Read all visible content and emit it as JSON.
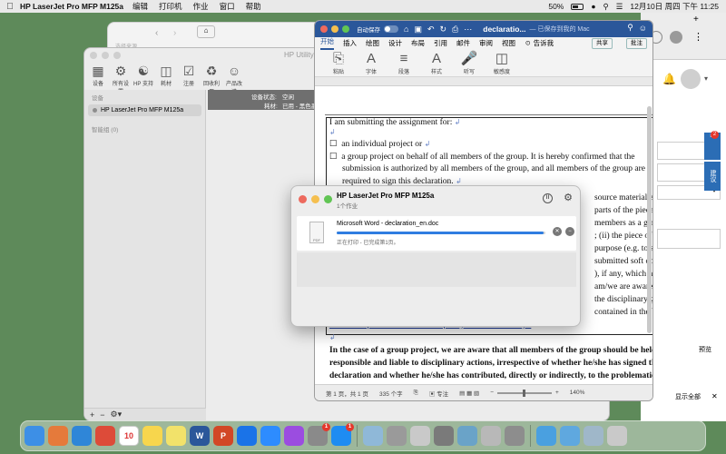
{
  "menubar": {
    "app_name": "HP LaserJet Pro MFP M125a",
    "menus": [
      "编辑",
      "打印机",
      "作业",
      "窗口",
      "帮助"
    ],
    "battery": "50%",
    "clock": "12月10日 周四 下午 11:25"
  },
  "hp_utility": {
    "title": "HP Utility",
    "toolbar": [
      "设备",
      "所有设置",
      "HP 支持",
      "耗材",
      "注册",
      "回收利用",
      "产品改进"
    ],
    "sidebar_header": "设备",
    "device": "HP LaserJet Pro MFP M125a",
    "smart_group": "智能组 (0)",
    "status_label": "设备状态:",
    "status_value": "空闲",
    "supply_label": "耗材:",
    "supply_value": "已用 - 黑色墨"
  },
  "word": {
    "autosave_label": "自动保存",
    "doc_title": "declaratio...",
    "doc_subtitle": "— 已保存到我的 Mac",
    "tabs": [
      "开始",
      "插入",
      "绘图",
      "设计",
      "布局",
      "引用",
      "邮件",
      "审阅",
      "视图"
    ],
    "tell_me": "告诉我",
    "share": "共享",
    "comment": "批注",
    "ribbon": [
      "粘贴",
      "字体",
      "段落",
      "样式",
      "听写",
      "敏感度"
    ],
    "lines": [
      "I am submitting the assignment for:",
      "an individual project or",
      "a group project on behalf of all members of the group. It is hereby confirmed that the",
      "submission is authorized by all members of the group, and all members of the group are",
      "required to sign this declaration.",
      "source material except to",
      "parts of the piece of",
      "members as a group,",
      "; (ii) the piece of work",
      "purpose (e.g. to satisfy",
      "submitted soft copy",
      "), if any, which has",
      "am/we are aware of",
      "the disciplinary guidelines",
      "contained in the University",
      "website http://www.cuhk.edu.hk/policy/academichonesty/.",
      "In the case of a group project, we are aware that all members of the group should be held",
      "responsible and liable to disciplinary actions, irrespective of whether he/she has signed the",
      "declaration and whether he/she has contributed, directly or indirectly, to the problematic"
    ],
    "status": {
      "page": "第 1 页，共 1 页",
      "words": "335 个字",
      "focus": "专注",
      "zoom": "140%"
    }
  },
  "print_queue": {
    "printer": "HP LaserJet Pro MFP M125a",
    "jobs_count": "1个作业",
    "job_name": "Microsoft Word - declaration_en.doc",
    "job_status": "正在打印 - 已完成第1页。",
    "progress": 0.99,
    "file_label": "PDF"
  },
  "chrome": {
    "badge": "2",
    "side_label": "建议",
    "preview": "预览",
    "show_all": "显示全部",
    "hidden_tab": "选择来源"
  },
  "dock": [
    {
      "name": "finder",
      "label": "",
      "color": "#3d8fe6"
    },
    {
      "name": "launchpad",
      "label": "",
      "color": "#e57a3b"
    },
    {
      "name": "safari",
      "label": "",
      "color": "#2f86d8"
    },
    {
      "name": "chrome",
      "label": "",
      "color": "#dd4b39"
    },
    {
      "name": "calendar",
      "label": "10",
      "color": "#ffffff"
    },
    {
      "name": "notes",
      "label": "",
      "color": "#f7d64d"
    },
    {
      "name": "stickies",
      "label": "",
      "color": "#f2e26a"
    },
    {
      "name": "word",
      "label": "W",
      "color": "#2b579a"
    },
    {
      "name": "powerpoint",
      "label": "P",
      "color": "#d24726"
    },
    {
      "name": "onedrive",
      "label": "",
      "color": "#1a73e8"
    },
    {
      "name": "zoom",
      "label": "",
      "color": "#2d8cff"
    },
    {
      "name": "podcasts",
      "label": "",
      "color": "#9b4de0"
    },
    {
      "name": "system-preferences",
      "label": "",
      "color": "#8a8a8a",
      "badge": "1"
    },
    {
      "name": "app-store",
      "label": "",
      "color": "#1e8cf2",
      "badge": "1"
    },
    {
      "name": "sep",
      "label": "",
      "color": ""
    },
    {
      "name": "preview",
      "label": "",
      "color": "#8fb8d8"
    },
    {
      "name": "printer-1",
      "label": "",
      "color": "#9a9a9a"
    },
    {
      "name": "keychain",
      "label": "",
      "color": "#c9c9c9"
    },
    {
      "name": "printer-2",
      "label": "",
      "color": "#7a7a7a"
    },
    {
      "name": "disk-utility",
      "label": "",
      "color": "#6aa3c8"
    },
    {
      "name": "scanner",
      "label": "",
      "color": "#b8b8b8"
    },
    {
      "name": "printer-3",
      "label": "",
      "color": "#8d8d8d"
    },
    {
      "name": "sep",
      "label": "",
      "color": ""
    },
    {
      "name": "downloads",
      "label": "",
      "color": "#4aa0e0"
    },
    {
      "name": "folder",
      "label": "",
      "color": "#5fa8df"
    },
    {
      "name": "window",
      "label": "",
      "color": "#9fb7c9"
    },
    {
      "name": "trash",
      "label": "",
      "color": "#c9c9c9"
    }
  ]
}
